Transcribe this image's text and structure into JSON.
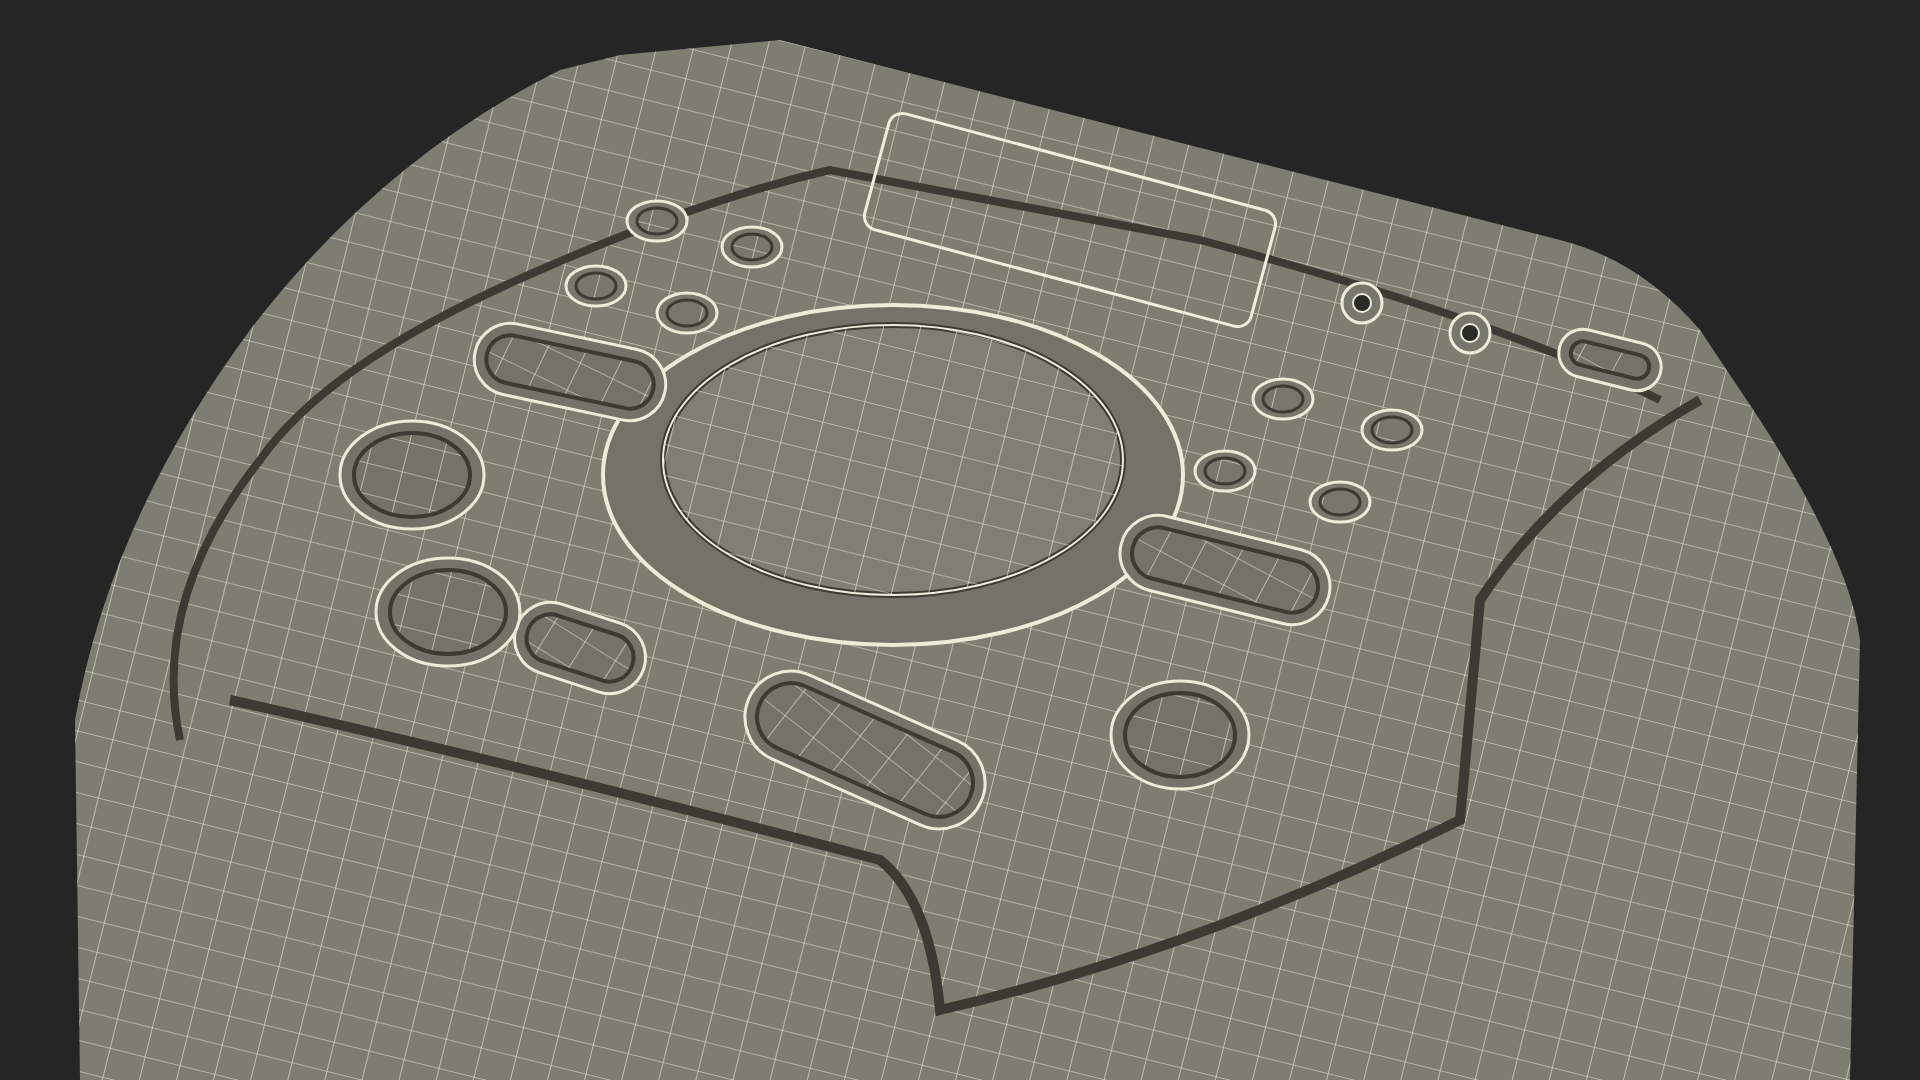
{
  "scene": {
    "kind": "wireframe"
  }
}
